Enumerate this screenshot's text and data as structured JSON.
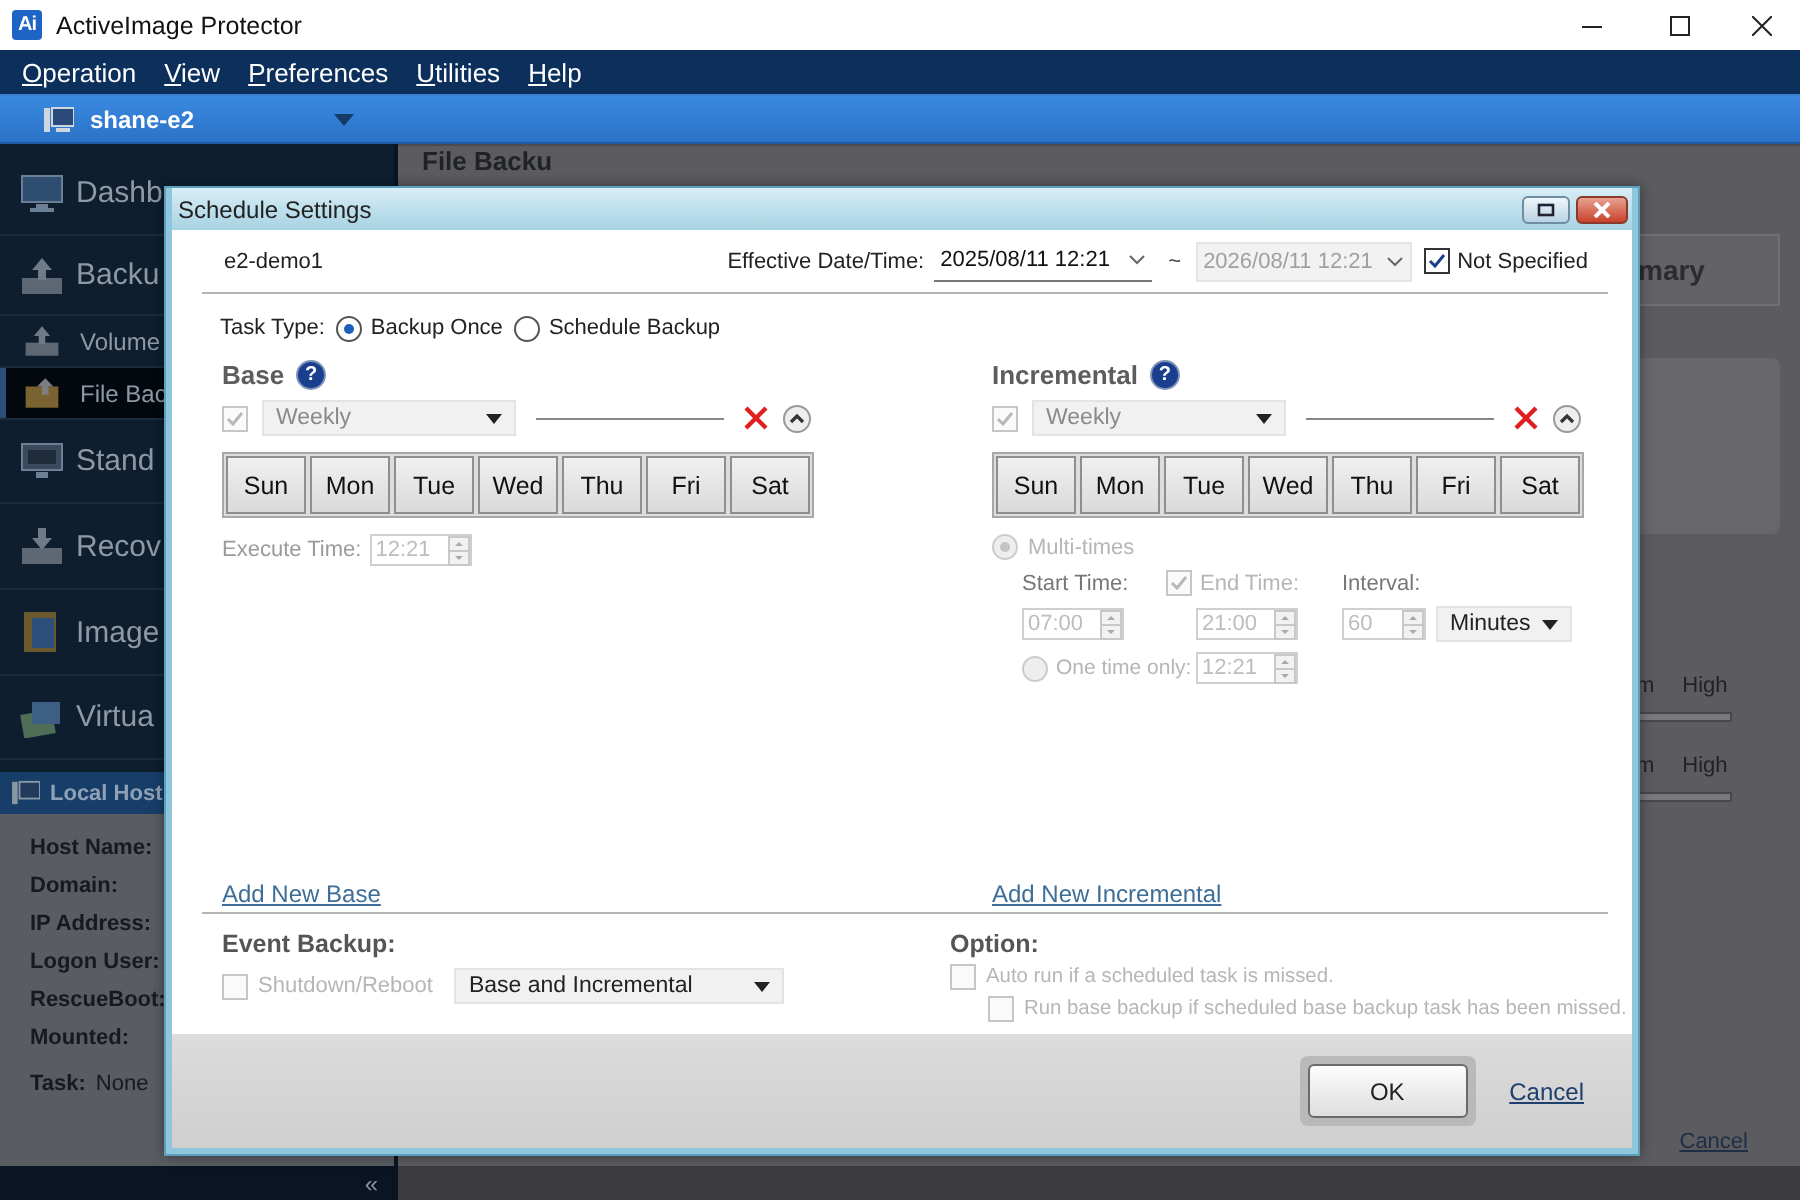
{
  "app": {
    "logo": "Ai",
    "title": "ActiveImage Protector"
  },
  "menu": [
    {
      "label": "Operation"
    },
    {
      "label": "View"
    },
    {
      "label": "Preferences"
    },
    {
      "label": "Utilities"
    },
    {
      "label": "Help"
    }
  ],
  "host_bar": {
    "host": "shane-e2"
  },
  "sidebar": {
    "items": [
      {
        "label": "Dashb",
        "kind": "main",
        "selected": false
      },
      {
        "label": "Backu",
        "kind": "main",
        "selected": false
      },
      {
        "label": "Volume",
        "kind": "sub",
        "selected": false
      },
      {
        "label": "File Bac",
        "kind": "sub",
        "selected": true
      },
      {
        "label": "Stand",
        "kind": "main",
        "selected": false
      },
      {
        "label": "Recov",
        "kind": "main",
        "selected": false
      },
      {
        "label": "Image",
        "kind": "main",
        "selected": false
      },
      {
        "label": "Virtua",
        "kind": "main",
        "selected": false
      }
    ],
    "local_host": {
      "title": "Local Host",
      "fields": [
        "Host Name:",
        "Domain:",
        "IP Address:",
        "Logon User:",
        "RescueBoot:",
        "Mounted:"
      ],
      "task_label": "Task:",
      "task_value": "None"
    },
    "collapse": "«"
  },
  "background": {
    "page_title": "File Backu",
    "tab": "mary",
    "sliders": [
      {
        "low": "m",
        "high": "High"
      },
      {
        "low": "m",
        "high": "High"
      }
    ],
    "cancel": "Cancel"
  },
  "dialog": {
    "title": "Schedule Settings",
    "task_name": "e2-demo1",
    "effective": {
      "label": "Effective Date/Time:",
      "start": "2025/08/11 12:21",
      "separator": "~",
      "end": {
        "value": "2026/08/11 12:21",
        "disabled": true
      },
      "not_specified": {
        "label": "Not Specified",
        "checked": true
      }
    },
    "task_type": {
      "label": "Task Type:",
      "options": [
        {
          "label": "Backup Once",
          "selected": true
        },
        {
          "label": "Schedule Backup",
          "selected": false
        }
      ]
    },
    "base": {
      "title": "Base",
      "help": "?",
      "enabled": {
        "checked": true,
        "disabled": true
      },
      "frequency": "Weekly",
      "days": [
        {
          "label": "Sun",
          "selected": false
        },
        {
          "label": "Mon",
          "selected": false
        },
        {
          "label": "Tue",
          "selected": false
        },
        {
          "label": "Wed",
          "selected": false
        },
        {
          "label": "Thu",
          "selected": false
        },
        {
          "label": "Fri",
          "selected": false
        },
        {
          "label": "Sat",
          "selected": false
        }
      ],
      "execute_label": "Execute Time:",
      "execute_time": "12:21",
      "add_link": "Add New Base"
    },
    "incremental": {
      "title": "Incremental",
      "help": "?",
      "enabled": {
        "checked": true,
        "disabled": true
      },
      "frequency": "Weekly",
      "days": [
        {
          "label": "Sun",
          "selected": false
        },
        {
          "label": "Mon",
          "selected": false
        },
        {
          "label": "Tue",
          "selected": false
        },
        {
          "label": "Wed",
          "selected": false
        },
        {
          "label": "Thu",
          "selected": false
        },
        {
          "label": "Fri",
          "selected": false
        },
        {
          "label": "Sat",
          "selected": false
        }
      ],
      "multi_times": {
        "label": "Multi-times",
        "selected": true,
        "disabled": true
      },
      "start_label": "Start Time:",
      "start_time": "07:00",
      "end": {
        "label": "End Time:",
        "checked": true,
        "disabled": true
      },
      "end_time": "21:00",
      "interval_label": "Interval:",
      "interval": "60",
      "unit": "Minutes",
      "one_time": {
        "label": "One time only:",
        "selected": false,
        "disabled": true,
        "time": "12:21"
      },
      "add_link": "Add New Incremental"
    },
    "event_backup": {
      "title": "Event Backup:",
      "shutdown": {
        "label": "Shutdown/Reboot",
        "checked": false,
        "disabled": true
      },
      "target": "Base and Incremental"
    },
    "option": {
      "title": "Option:",
      "items": [
        {
          "label": "Auto run if a scheduled task is missed.",
          "checked": false,
          "disabled": true,
          "children": [
            {
              "label": "Run base backup if scheduled base backup task has been missed.",
              "checked": false,
              "disabled": true
            }
          ]
        }
      ]
    },
    "buttons": {
      "ok": "OK",
      "cancel": "Cancel"
    }
  }
}
